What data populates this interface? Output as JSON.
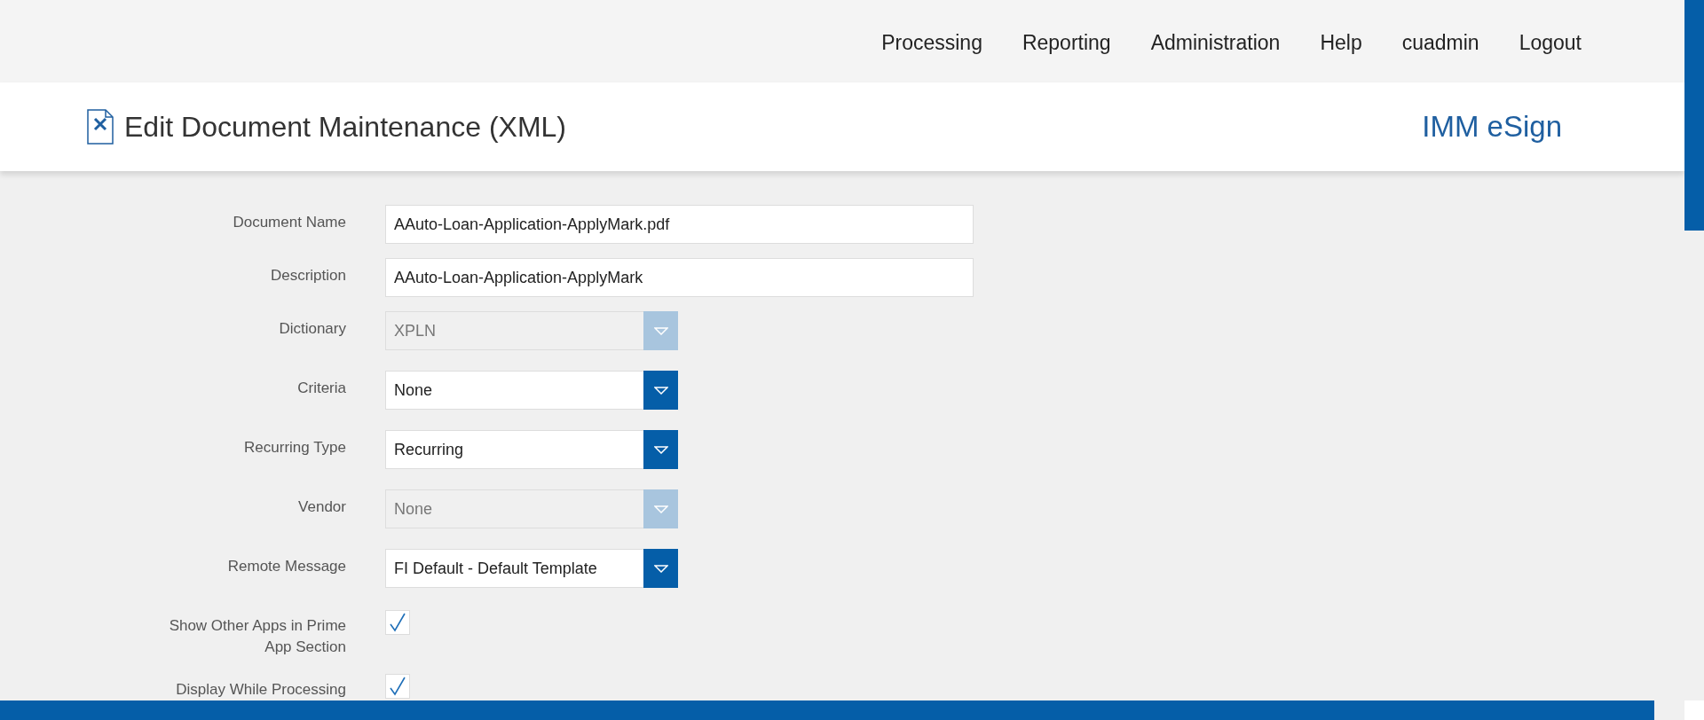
{
  "nav": {
    "items": [
      "Processing",
      "Reporting",
      "Administration",
      "Help",
      "cuadmin",
      "Logout"
    ]
  },
  "header": {
    "title": "Edit Document Maintenance (XML)",
    "brand": "IMM eSign"
  },
  "form": {
    "fields": [
      {
        "kind": "text",
        "label": "Document Name",
        "value": "AAuto-Loan-Application-ApplyMark.pdf"
      },
      {
        "kind": "text",
        "label": "Description",
        "value": "AAuto-Loan-Application-ApplyMark"
      },
      {
        "kind": "select",
        "label": "Dictionary",
        "value": "XPLN",
        "disabled": true
      },
      {
        "kind": "select",
        "label": "Criteria",
        "value": "None",
        "disabled": false
      },
      {
        "kind": "select",
        "label": "Recurring Type",
        "value": "Recurring",
        "disabled": false
      },
      {
        "kind": "select",
        "label": "Vendor",
        "value": "None",
        "disabled": true
      },
      {
        "kind": "select",
        "label": "Remote Message",
        "value": "FI Default - Default Template",
        "disabled": false
      },
      {
        "kind": "checkbox",
        "label": "Show Other Apps in Prime App Section",
        "checked": true
      },
      {
        "kind": "checkbox",
        "label": "Display While Processing",
        "checked": true
      }
    ]
  }
}
